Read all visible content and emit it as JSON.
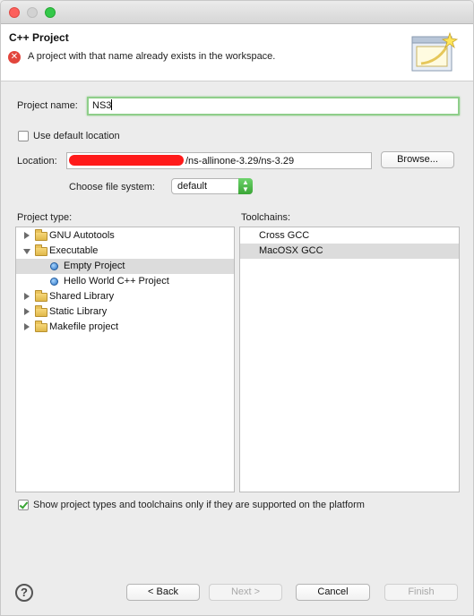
{
  "window": {
    "title": ""
  },
  "header": {
    "title": "C++ Project",
    "message": "A project with that name already exists in the workspace.",
    "error_icon": "error-icon",
    "graphic_icon": "wizard-banner-icon"
  },
  "form": {
    "project_name_label": "Project name:",
    "project_name_value": "NS3",
    "use_default_location_label": "Use default location",
    "use_default_location_checked": false,
    "location_label": "Location:",
    "location_value": "/ns-allinone-3.29/ns-3.29",
    "browse_label": "Browse...",
    "file_system_label": "Choose file system:",
    "file_system_value": "default"
  },
  "project_type": {
    "label": "Project type:",
    "items": [
      {
        "label": "GNU Autotools",
        "kind": "folder",
        "expanded": false,
        "depth": 0,
        "selected": false
      },
      {
        "label": "Executable",
        "kind": "folder",
        "expanded": true,
        "depth": 0,
        "selected": false
      },
      {
        "label": "Empty Project",
        "kind": "leaf",
        "depth": 1,
        "selected": true
      },
      {
        "label": "Hello World C++ Project",
        "kind": "leaf",
        "depth": 1,
        "selected": false
      },
      {
        "label": "Shared Library",
        "kind": "folder",
        "expanded": false,
        "depth": 0,
        "selected": false
      },
      {
        "label": "Static Library",
        "kind": "folder",
        "expanded": false,
        "depth": 0,
        "selected": false
      },
      {
        "label": "Makefile project",
        "kind": "folder",
        "expanded": false,
        "depth": 0,
        "selected": false
      }
    ]
  },
  "toolchains": {
    "label": "Toolchains:",
    "items": [
      {
        "label": "Cross GCC",
        "selected": false
      },
      {
        "label": "MacOSX GCC",
        "selected": true
      }
    ]
  },
  "filter": {
    "label": "Show project types and toolchains only if they are supported on the platform",
    "checked": true
  },
  "buttons": {
    "back": "< Back",
    "next": "Next >",
    "cancel": "Cancel",
    "finish": "Finish",
    "help_glyph": "?"
  },
  "colors": {
    "accent_green": "#3aa535",
    "error_red": "#e2453c",
    "selection_gray": "#dcdcdc"
  }
}
